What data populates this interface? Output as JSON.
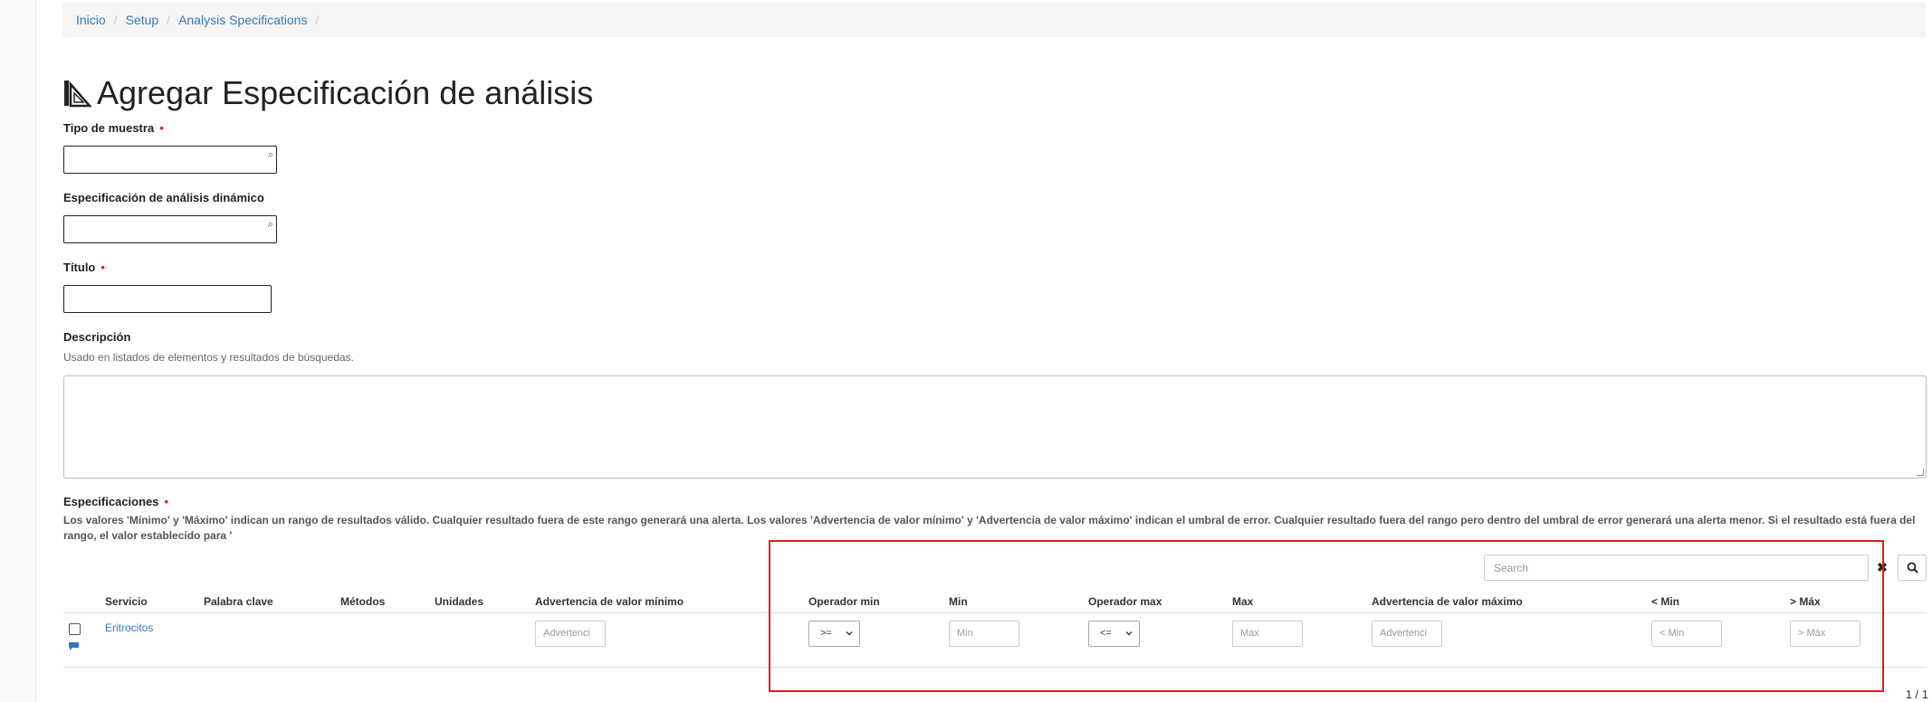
{
  "breadcrumb": {
    "items": [
      "Inicio",
      "Setup",
      "Analysis Specifications"
    ],
    "separator": "/"
  },
  "page": {
    "title": "Agregar Especificación de análisis",
    "title_icon": "ruler-triangle-icon"
  },
  "form": {
    "required_marker": "•",
    "sample_type_label": "Tipo de muestra",
    "dynamic_spec_label": "Especificación de análisis dinámico",
    "title_label": "Título",
    "description_label": "Descripción",
    "description_help": "Usado en listados de elementos y resultados de búsquedas.",
    "specs_label": "Especificaciones",
    "specs_help": "Los valores 'Mínimo' y 'Máximo' indican un rango de resultados válido. Cualquier resultado fuera de este rango generará una alerta. Los valores 'Advertencia de valor mínimo' y 'Advertencia de valor máximo' indican el umbral de error. Cualquier resultado fuera del rango pero dentro del umbral de error generará una alerta menor. Si el resultado está fuera del rango, el valor establecido para '"
  },
  "table": {
    "search_placeholder": "Search",
    "columns": [
      "Servicio",
      "Palabra clave",
      "Métodos",
      "Unidades",
      "Advertencia de valor mínimo",
      "Operador min",
      "Min",
      "Operador max",
      "Max",
      "Advertencia de valor máximo",
      "< Min",
      "> Máx"
    ],
    "row": {
      "service": "Eritrocitos",
      "warn_min_placeholder": "Advertenci",
      "min_operator": ">=",
      "min_placeholder": "Min",
      "max_operator": "<=",
      "max_placeholder": "Max",
      "warn_max_placeholder": "Advertenci",
      "lt_min_placeholder": "< Min",
      "gt_max_placeholder": "> Máx"
    },
    "pagination": "1 / 1"
  },
  "colors": {
    "link": "#337ab7",
    "required": "#d9252b",
    "highlight": "#e01e1e"
  }
}
